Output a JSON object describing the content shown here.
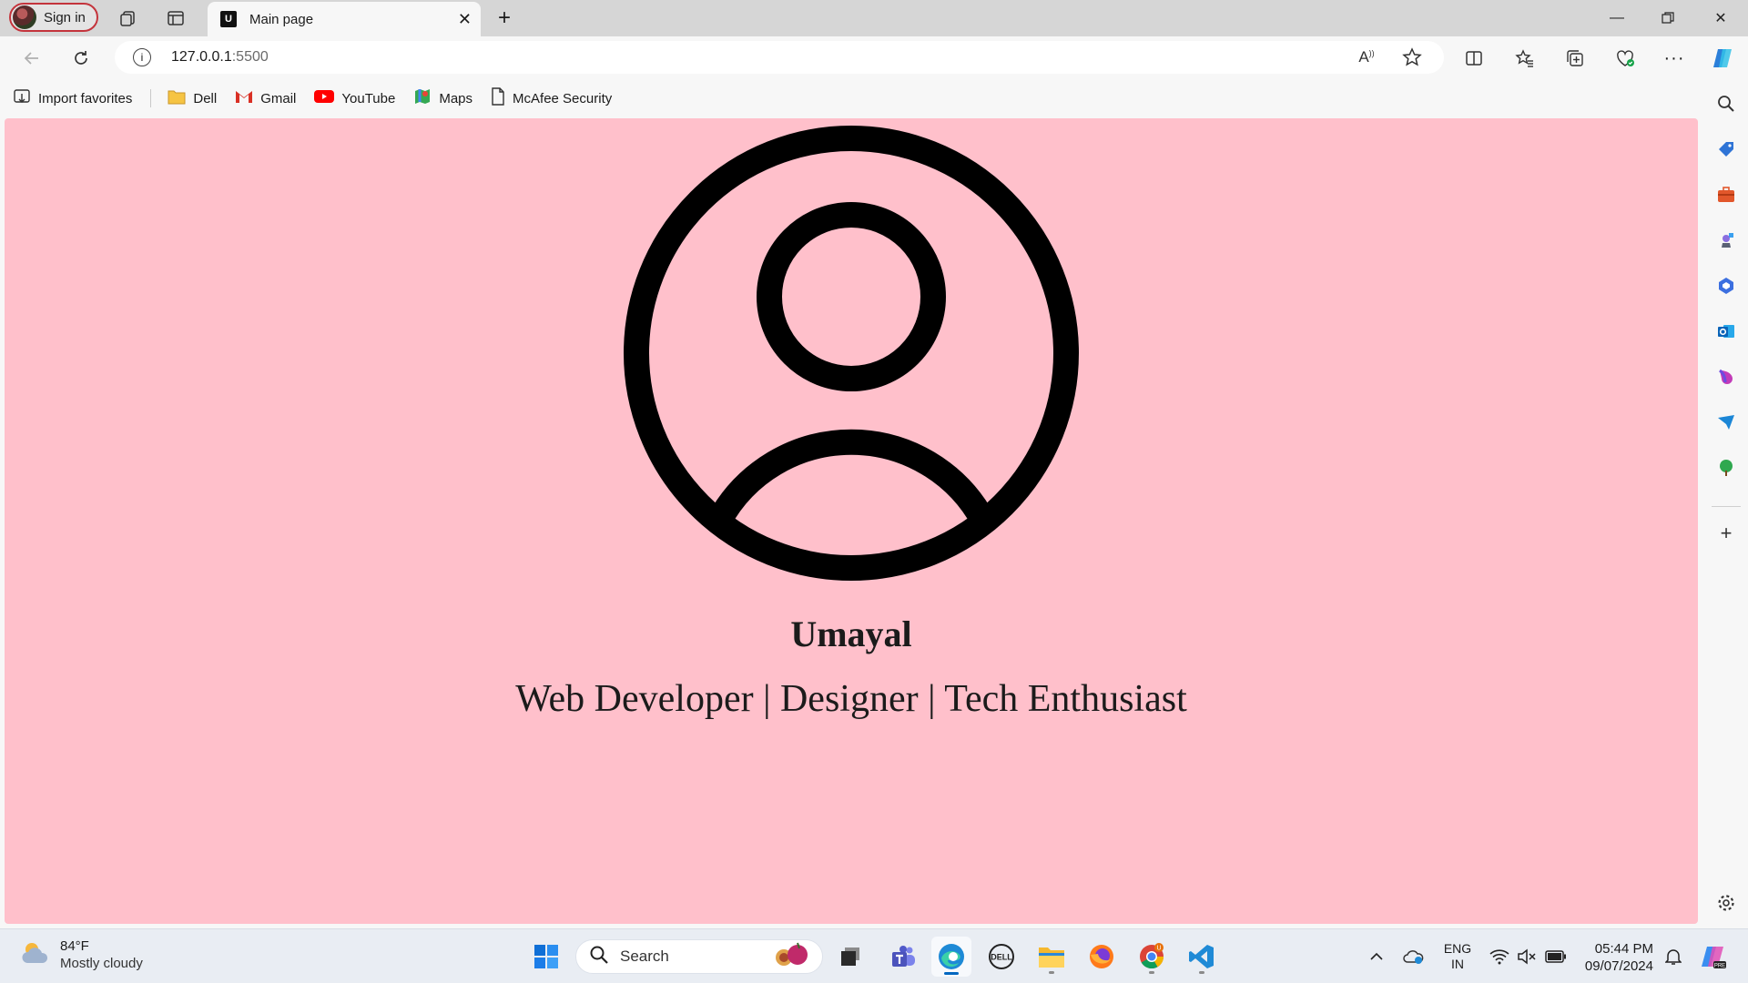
{
  "browser": {
    "signin_label": "Sign in",
    "tab_title": "Main page",
    "tab_favicon_letter": "U",
    "url_host": "127.0.0.1",
    "url_port": ":5500"
  },
  "bookmarks": [
    {
      "label": "Import favorites",
      "icon": "import-icon"
    },
    {
      "label": "Dell",
      "icon": "folder-icon"
    },
    {
      "label": "Gmail",
      "icon": "gmail-icon"
    },
    {
      "label": "YouTube",
      "icon": "youtube-icon"
    },
    {
      "label": "Maps",
      "icon": "maps-icon"
    },
    {
      "label": "McAfee Security",
      "icon": "page-icon"
    }
  ],
  "page": {
    "name": "Umayal",
    "tagline": "Web Developer | Designer | Tech Enthusiast",
    "background": "#ffc0cb"
  },
  "taskbar": {
    "temperature": "84°F",
    "weather": "Mostly cloudy",
    "search_placeholder": "Search",
    "lang_top": "ENG",
    "lang_bottom": "IN",
    "time": "05:44 PM",
    "date": "09/07/2024"
  }
}
